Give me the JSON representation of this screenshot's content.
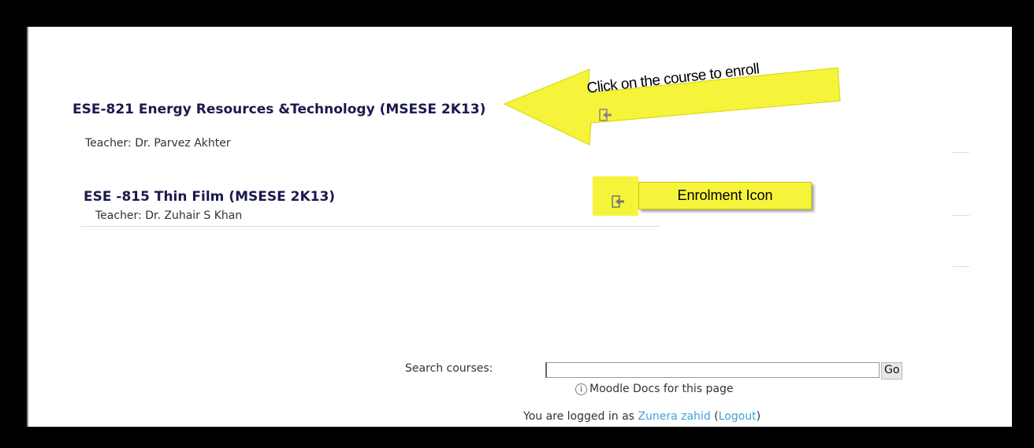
{
  "courses": [
    {
      "title": "ESE-821 Energy Resources &Technology (MSESE 2K13)",
      "teacher": "Teacher: Dr. Parvez Akhter"
    },
    {
      "title": "ESE -815 Thin Film (MSESE 2K13)",
      "teacher": "Teacher: Dr. Zuhair S Khan"
    }
  ],
  "annotations": {
    "arrow_text": "Click on the course to enroll",
    "callout_text": "Enrolment Icon",
    "highlight_color": "#f6f43a"
  },
  "footer": {
    "search_label": "Search courses:",
    "search_value": "",
    "go_label": "Go",
    "docs_link": "Moodle Docs for this page",
    "login_prefix": "You are logged in as ",
    "user_name": "Zunera zahid",
    "logout_open": " (",
    "logout_label": "Logout",
    "logout_close": ")"
  },
  "icons": {
    "enrol": "enrol-icon",
    "info": "info-icon"
  }
}
